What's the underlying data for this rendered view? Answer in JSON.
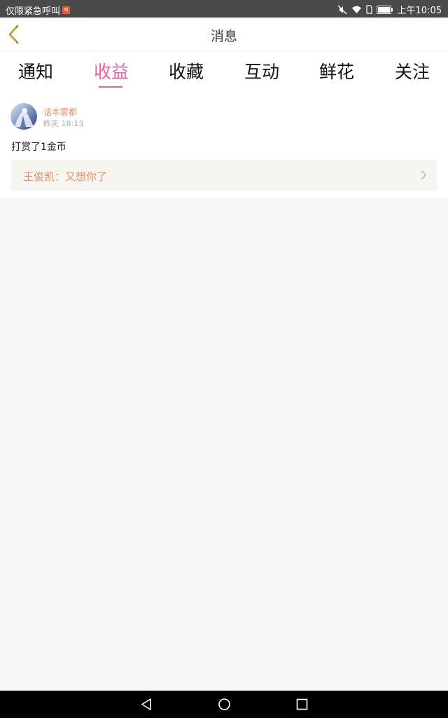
{
  "status_bar": {
    "left_text": "仅限紧急呼叫",
    "badge": "N",
    "time": "上午10:05"
  },
  "header": {
    "title": "消息"
  },
  "tabs": [
    {
      "label": "通知"
    },
    {
      "label": "收益",
      "active": true
    },
    {
      "label": "收藏"
    },
    {
      "label": "互动"
    },
    {
      "label": "鲜花"
    },
    {
      "label": "关注"
    }
  ],
  "item": {
    "username": "话本雾都",
    "timestamp": "昨天 18:13",
    "message": "打赏了1金币",
    "quote": "王俊凯：又想你了"
  },
  "colors": {
    "accent": "#e6639e",
    "username": "#e9916a",
    "quote_bg": "#f6f5ef",
    "page_bg": "#f8f6f6"
  }
}
